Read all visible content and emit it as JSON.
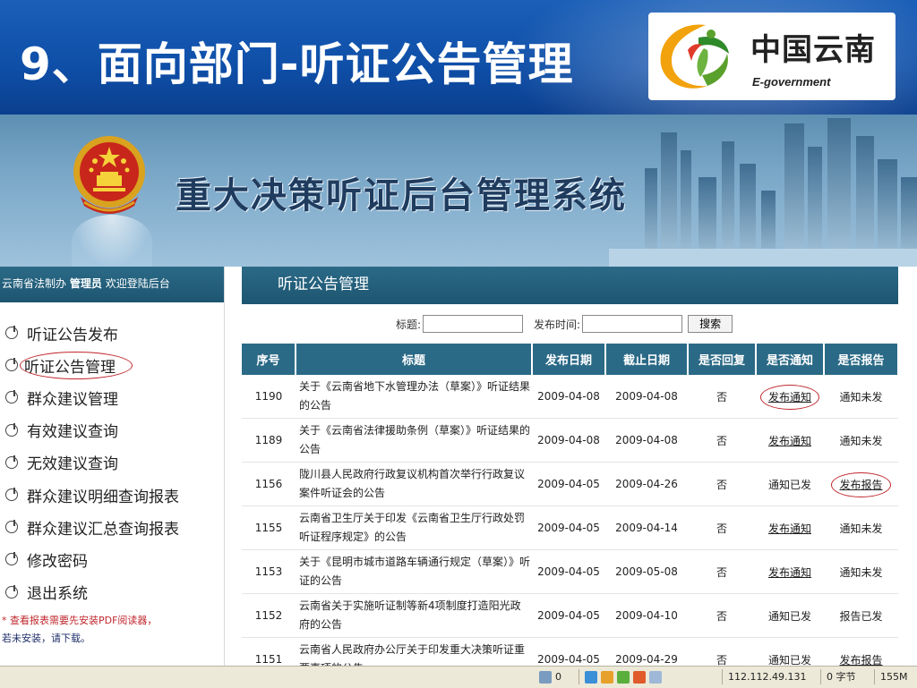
{
  "slide": {
    "title": "9、面向部门-听证公告管理",
    "logo_text": "中国云南",
    "logo_subtext": "E-government"
  },
  "system": {
    "title": "重大决策听证后台管理系统"
  },
  "sidebar": {
    "welcome_org": "云南省法制办",
    "welcome_role": "管理员",
    "welcome_text": "欢迎登陆后台",
    "items": [
      {
        "label": "听证公告发布"
      },
      {
        "label": "听证公告管理"
      },
      {
        "label": "群众建议管理"
      },
      {
        "label": "有效建议查询"
      },
      {
        "label": "无效建议查询"
      },
      {
        "label": "群众建议明细查询报表"
      },
      {
        "label": "群众建议汇总查询报表"
      },
      {
        "label": "修改密码"
      },
      {
        "label": "退出系统"
      }
    ],
    "note_line1": "* 查看报表需要先安装PDF阅读器，",
    "note_line2": "若未安装，请下载。"
  },
  "main": {
    "heading": "听证公告管理",
    "search": {
      "title_label": "标题:",
      "title_value": "",
      "date_label": "发布时间:",
      "date_value": "",
      "button_label": "搜索"
    },
    "table": {
      "headers": [
        "序号",
        "标题",
        "发布日期",
        "截止日期",
        "是否回复",
        "是否通知",
        "是否报告"
      ],
      "rows": [
        {
          "id": "1190",
          "title": "关于《云南省地下水管理办法（草案）》听证结果的公告",
          "publish": "2009-04-08",
          "deadline": "2009-04-08",
          "reply": "否",
          "notify": "发布通知",
          "report": "通知未发"
        },
        {
          "id": "1189",
          "title": "关于《云南省法律援助条例（草案）》听证结果的公告",
          "publish": "2009-04-08",
          "deadline": "2009-04-08",
          "reply": "否",
          "notify": "发布通知",
          "report": "通知未发"
        },
        {
          "id": "1156",
          "title": "陇川县人民政府行政复议机构首次举行行政复议案件听证会的公告",
          "publish": "2009-04-05",
          "deadline": "2009-04-26",
          "reply": "否",
          "notify": "通知已发",
          "report": "发布报告"
        },
        {
          "id": "1155",
          "title": "云南省卫生厅关于印发《云南省卫生厅行政处罚听证程序规定》的公告",
          "publish": "2009-04-05",
          "deadline": "2009-04-14",
          "reply": "否",
          "notify": "发布通知",
          "report": "通知未发"
        },
        {
          "id": "1153",
          "title": "关于《昆明市城市道路车辆通行规定（草案）》听证的公告",
          "publish": "2009-04-05",
          "deadline": "2009-05-08",
          "reply": "否",
          "notify": "发布通知",
          "report": "通知未发"
        },
        {
          "id": "1152",
          "title": "云南省关于实施听证制等新4项制度打造阳光政府的公告",
          "publish": "2009-04-05",
          "deadline": "2009-04-10",
          "reply": "否",
          "notify": "通知已发",
          "report": "报告已发"
        },
        {
          "id": "1151",
          "title": "云南省人民政府办公厅关于印发重大决策听证重要事项的公告",
          "publish": "2009-04-05",
          "deadline": "2009-04-29",
          "reply": "否",
          "notify": "通知已发",
          "report": "发布报告"
        }
      ]
    }
  },
  "statusbar": {
    "count": "0",
    "ip": "112.112.49.131",
    "bytes": "0 字节",
    "memory": "155M"
  },
  "colors": {
    "slide_blue": "#0e4ea7",
    "header_teal": "#2b6a87",
    "annotation_red": "#c0272d"
  }
}
